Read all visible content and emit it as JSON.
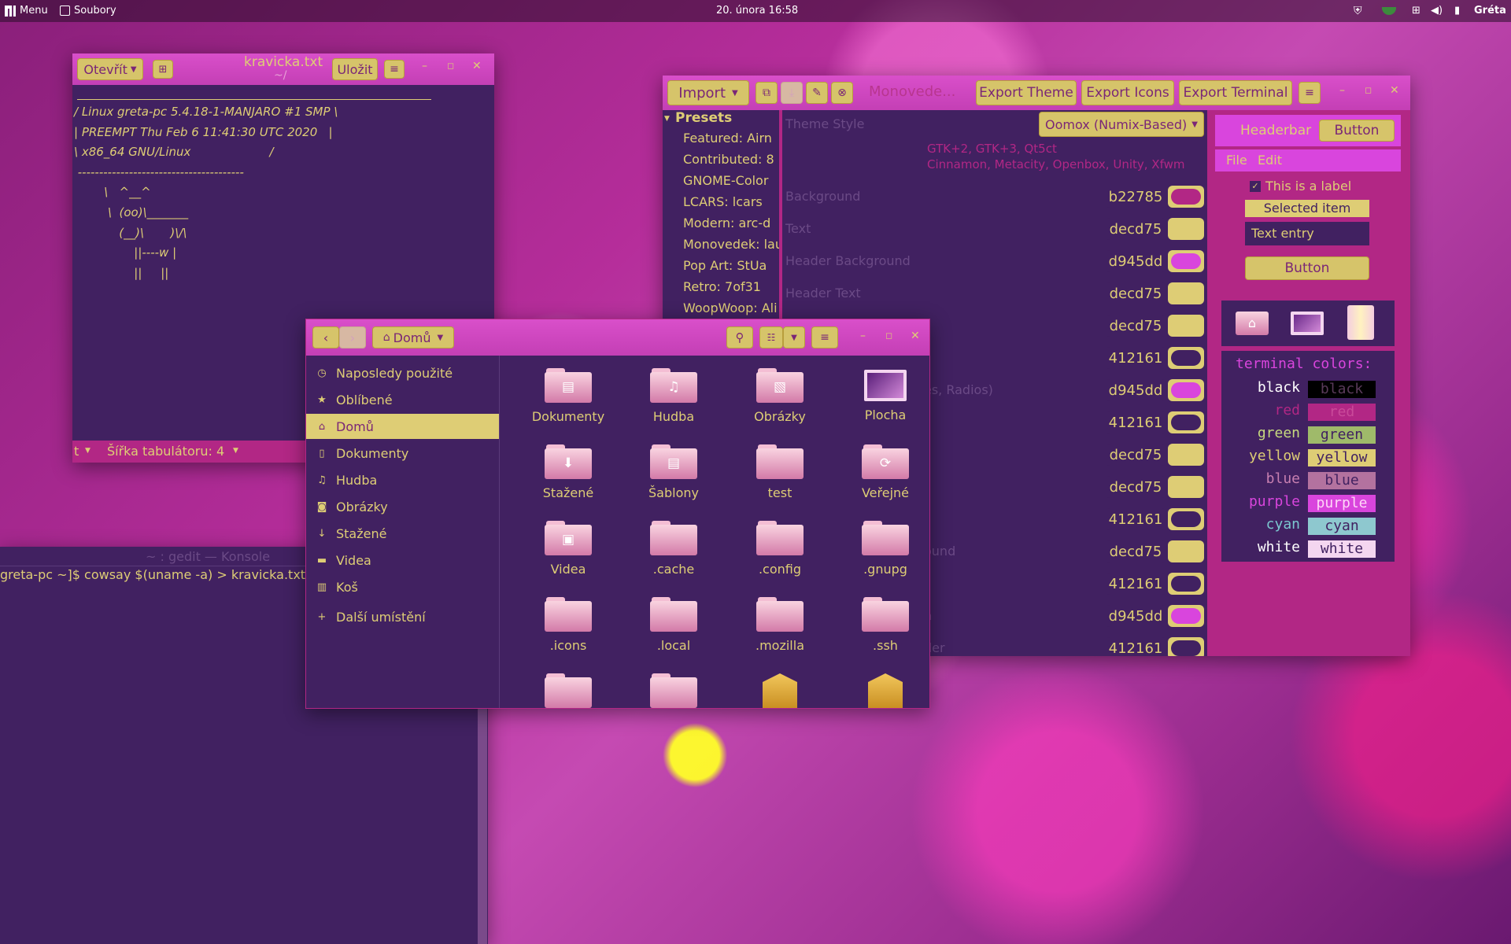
{
  "topbar": {
    "menu": "Menu",
    "files": "Soubory",
    "clock": "20. února 16:58",
    "user": "Gréta"
  },
  "gedit": {
    "open": "Otevřít",
    "title": "kravicka.txt",
    "subtitle": "~/",
    "save": "Uložit",
    "lines": [
      "/ Linux greta-pc 5.4.18-1-MANJARO #1 SMP \\",
      "| PREEMPT Thu Feb 6 11:41:30 UTC 2020   |",
      "\\ x86_64 GNU/Linux                     /",
      " ---------------------------------------",
      "        \\   ^__^",
      "         \\  (oo)\\_______",
      "            (__)\\       )\\/\\",
      "                ||----w |",
      "                ||     ||"
    ],
    "status_left": "t",
    "status_tab": "Šířka tabulátoru: 4"
  },
  "konsole": {
    "title": "~ : gedit — Konsole",
    "line": "greta-pc ~]$ cowsay $(uname -a) > kravicka.txt"
  },
  "nautilus": {
    "location": "Domů",
    "sidebar": [
      {
        "label": "Naposledy použité",
        "icon": "◷"
      },
      {
        "label": "Oblíbené",
        "icon": "★"
      },
      {
        "label": "Domů",
        "icon": "⌂"
      },
      {
        "label": "Dokumenty",
        "icon": "▯"
      },
      {
        "label": "Hudba",
        "icon": "♫"
      },
      {
        "label": "Obrázky",
        "icon": "◙"
      },
      {
        "label": "Stažené",
        "icon": "↓"
      },
      {
        "label": "Videa",
        "icon": "▬"
      },
      {
        "label": "Koš",
        "icon": "▥"
      }
    ],
    "other": "Další umístění",
    "other_icon": "+",
    "files": [
      {
        "label": "Dokumenty",
        "glyph": "▤"
      },
      {
        "label": "Hudba",
        "glyph": "♫"
      },
      {
        "label": "Obrázky",
        "glyph": "▧"
      },
      {
        "label": "Plocha",
        "glyph": ""
      },
      {
        "label": "Stažené",
        "glyph": "⬇"
      },
      {
        "label": "Šablony",
        "glyph": "▤"
      },
      {
        "label": "test",
        "glyph": ""
      },
      {
        "label": "Veřejné",
        "glyph": "⟳"
      },
      {
        "label": "Videa",
        "glyph": "▣"
      },
      {
        "label": ".cache",
        "glyph": ""
      },
      {
        "label": ".config",
        "glyph": ""
      },
      {
        "label": ".gnupg",
        "glyph": ""
      },
      {
        "label": ".icons",
        "glyph": ""
      },
      {
        "label": ".local",
        "glyph": ""
      },
      {
        "label": ".mozilla",
        "glyph": ""
      },
      {
        "label": ".ssh",
        "glyph": ""
      }
    ]
  },
  "oomox": {
    "import": "Import",
    "title": "Monovede...",
    "export_theme": "Export Theme",
    "export_icons": "Export Icons",
    "export_terminal": "Export Terminal",
    "presets_header": "Presets",
    "presets": [
      "Featured: Airn",
      "Contributed: 8",
      "GNOME-Color",
      "LCARS: lcars",
      "Modern: arc-d",
      "Monovedek: lau",
      "Pop Art: StUa",
      "Retro: 7of31",
      "WoopWoop: Ali"
    ],
    "theme_style_label": "Theme Style",
    "theme_style_value": "Oomox (Numix-Based)",
    "style_note1": "GTK+2, GTK+3, Qt5ct",
    "style_note2": "Cinnamon, Metacity, Openbox, Unity, Xfwm",
    "labels": [
      "Background",
      "Text",
      "Header Background",
      "Header Text",
      "",
      "",
      "es, Radios)",
      "",
      "",
      "",
      "",
      "ound",
      "",
      "n",
      "der"
    ],
    "colors": [
      {
        "hex": "b22785",
        "swatch": "#b22785"
      },
      {
        "hex": "decd75",
        "swatch": "#decd75"
      },
      {
        "hex": "d945dd",
        "swatch": "#d945dd"
      },
      {
        "hex": "decd75",
        "swatch": "#decd75"
      },
      {
        "hex": "decd75",
        "swatch": "#decd75"
      },
      {
        "hex": "412161",
        "swatch": "#412161"
      },
      {
        "hex": "d945dd",
        "swatch": "#d945dd"
      },
      {
        "hex": "412161",
        "swatch": "#412161"
      },
      {
        "hex": "decd75",
        "swatch": "#decd75"
      },
      {
        "hex": "decd75",
        "swatch": "#decd75"
      },
      {
        "hex": "412161",
        "swatch": "#412161"
      },
      {
        "hex": "decd75",
        "swatch": "#decd75"
      },
      {
        "hex": "412161",
        "swatch": "#412161"
      },
      {
        "hex": "d945dd",
        "swatch": "#d945dd"
      },
      {
        "hex": "412161",
        "swatch": "#412161"
      }
    ],
    "preview": {
      "headerbar": "Headerbar",
      "button": "Button",
      "menu_file": "File",
      "menu_edit": "Edit",
      "label": "This is a label",
      "selected": "Selected item",
      "entry": "Text entry",
      "button2": "Button",
      "terminal_title": "terminal colors:",
      "terminal": [
        {
          "name": "black",
          "fg": "#ffffff",
          "box": "#000000",
          "boxfg": "#5a3a5a"
        },
        {
          "name": "red",
          "fg": "#b22785",
          "box": "#b22785",
          "boxfg": "#c94a9a"
        },
        {
          "name": "green",
          "fg": "#c6d97e",
          "box": "#9fba6a",
          "boxfg": "#412161"
        },
        {
          "name": "yellow",
          "fg": "#decd75",
          "box": "#decd75",
          "boxfg": "#412161"
        },
        {
          "name": "blue",
          "fg": "#c77fb0",
          "box": "#b3729f",
          "boxfg": "#412161"
        },
        {
          "name": "purple",
          "fg": "#d945dd",
          "box": "#d945dd",
          "boxfg": "#ffd6f8"
        },
        {
          "name": "cyan",
          "fg": "#7bc7d0",
          "box": "#8ec8cf",
          "boxfg": "#412161"
        },
        {
          "name": "white",
          "fg": "#ffffff",
          "box": "#f4d6f0",
          "boxfg": "#412161"
        }
      ]
    }
  },
  "colors": {
    "bg": "#412161",
    "header": "#d945dd",
    "text": "#decd75",
    "accent": "#b22785"
  }
}
